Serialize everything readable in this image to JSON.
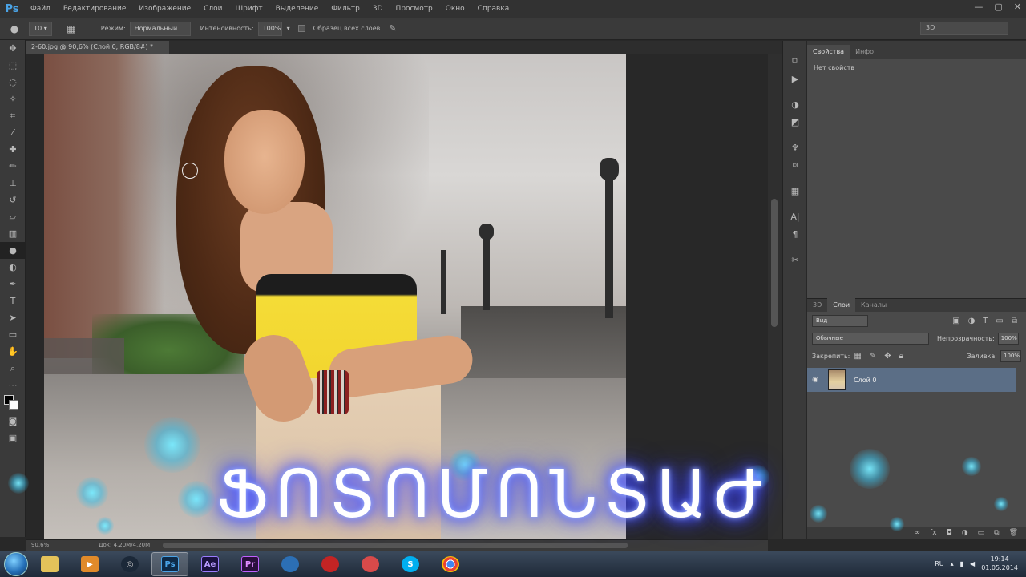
{
  "app": {
    "logo": "Ps",
    "menu": [
      "Файл",
      "Редактирование",
      "Изображение",
      "Слои",
      "Шрифт",
      "Выделение",
      "Фильтр",
      "3D",
      "Просмотр",
      "Окно",
      "Справка"
    ]
  },
  "window_controls": {
    "minimize": "—",
    "maximize": "▢",
    "close": "✕"
  },
  "options_bar": {
    "brush_size": "10",
    "mode_label": "Режим:",
    "mode_value": "Нормальный",
    "intensity_label": "Интенсивность:",
    "intensity_value": "100%",
    "sample_all_label": "Образец всех слоев",
    "workspace": "3D"
  },
  "document": {
    "tab_title": "2-60.jpg @ 90,6% (Слой 0, RGB/8#) *",
    "zoom": "90,6%",
    "doc_size": "Док: 4,20M/4,20M"
  },
  "properties_panel": {
    "tabs": [
      "Свойства",
      "Инфо"
    ],
    "text": "Нет свойств"
  },
  "layers_panel": {
    "tabs": [
      "3D",
      "Слои",
      "Каналы"
    ],
    "filter_kind": "Вид",
    "blend_mode": "Обычные",
    "opacity_label": "Непрозрачность:",
    "opacity_value": "100%",
    "lock_label": "Закрепить:",
    "fill_label": "Заливка:",
    "fill_value": "100%",
    "layer_name": "Слой 0"
  },
  "overlay": {
    "title": "ՖՈՏՈՄՈՆՏԱԺ"
  },
  "taskbar": {
    "apps": [
      "explorer",
      "media-player",
      "steam",
      "photoshop",
      "after-effects",
      "premiere",
      "app-blue",
      "record-app",
      "app-red",
      "skype",
      "chrome"
    ],
    "app_labels": {
      "photoshop": "Ps",
      "after_effects": "Ae",
      "premiere": "Pr",
      "skype": "S"
    },
    "lang": "RU",
    "time": "19:14",
    "date": "01.05.2014"
  },
  "colors": {
    "accent_blue": "#4aa3e6",
    "selected_layer": "#5b6e86",
    "glow": "#3c45ff"
  }
}
